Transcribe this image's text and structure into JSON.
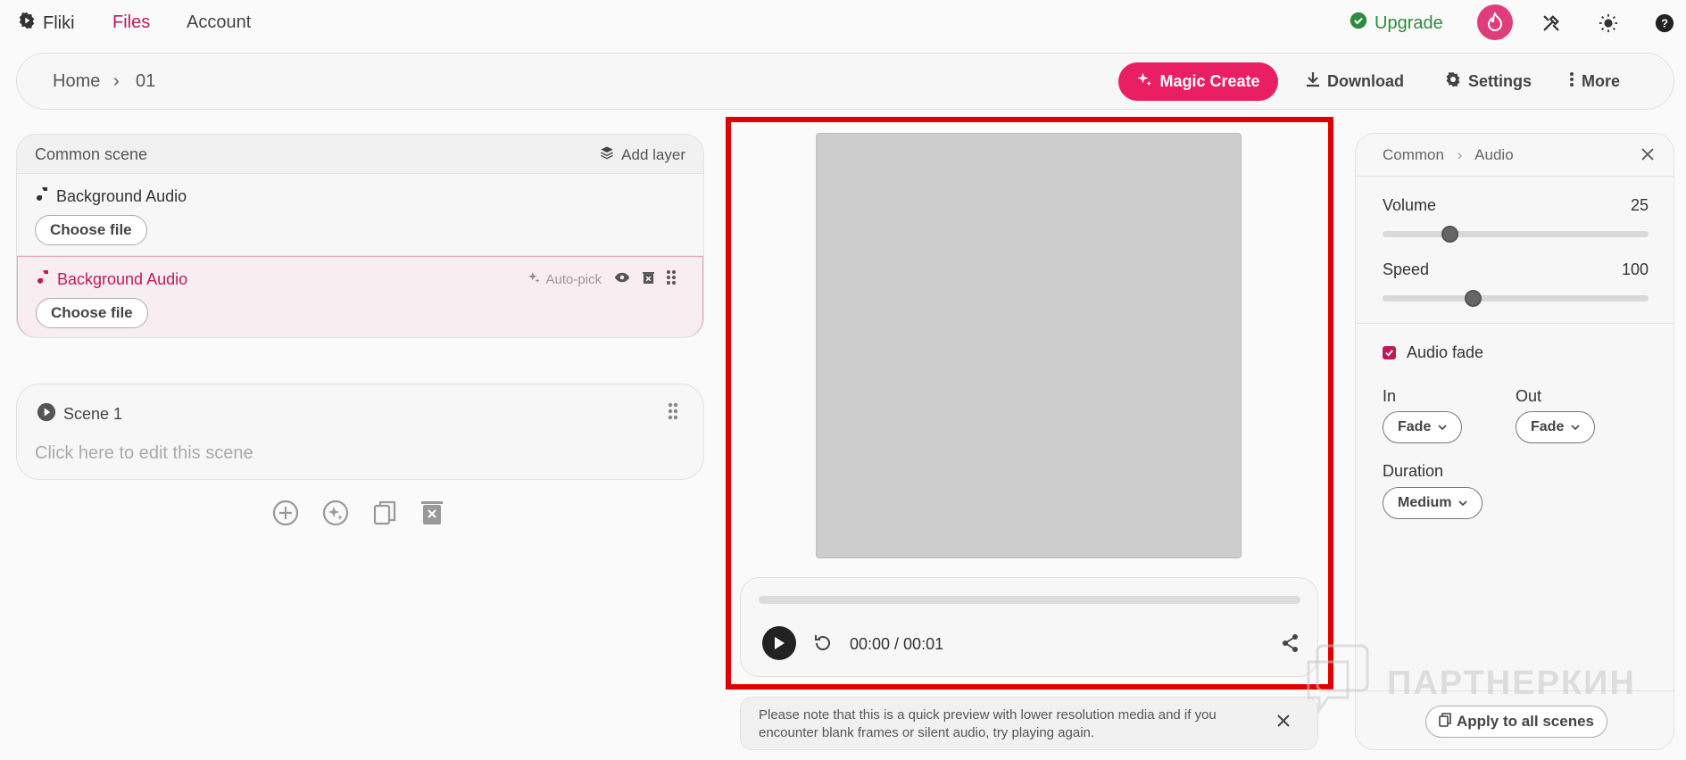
{
  "nav": {
    "brand": "Fliki",
    "links": [
      "Files",
      "Account"
    ],
    "active": "Files",
    "upgrade_label": "Upgrade",
    "icons": [
      "tools-icon",
      "theme-sun-icon",
      "help-icon"
    ]
  },
  "toolbar": {
    "breadcrumb": [
      "Home",
      "01"
    ],
    "magic_label": "Magic Create",
    "download_label": "Download",
    "settings_label": "Settings",
    "more_label": "More"
  },
  "common_scene": {
    "title": "Common scene",
    "add_layer_label": "Add layer",
    "layers": [
      {
        "title": "Background Audio",
        "button": "Choose file"
      },
      {
        "title": "Background Audio",
        "button": "Choose file",
        "autopick": "Auto-pick"
      }
    ]
  },
  "scene": {
    "title": "Scene 1",
    "hint": "Click here to edit this scene"
  },
  "player": {
    "time": "00:00 / 00:01",
    "progress": 0.0
  },
  "note": {
    "text": "Please note that this is a quick preview with lower resolution media and if you encounter blank frames or silent audio, try playing again."
  },
  "right_panel": {
    "breadcrumb": [
      "Common",
      "Audio"
    ],
    "volume": {
      "label": "Volume",
      "value": "25",
      "fraction": 0.25
    },
    "speed": {
      "label": "Speed",
      "value": "100",
      "fraction": 0.34
    },
    "audio_fade": {
      "label": "Audio fade",
      "checked": true
    },
    "fade_in": {
      "label": "In",
      "value": "Fade"
    },
    "fade_out": {
      "label": "Out",
      "value": "Fade"
    },
    "duration": {
      "label": "Duration",
      "value": "Medium"
    },
    "apply_label": "Apply to all scenes"
  },
  "watermark": "ПАРТНЕРКИН",
  "colors": {
    "accent": "#e91e63",
    "upgrade": "#2e8b3e",
    "highlight_border": "#e00000"
  }
}
